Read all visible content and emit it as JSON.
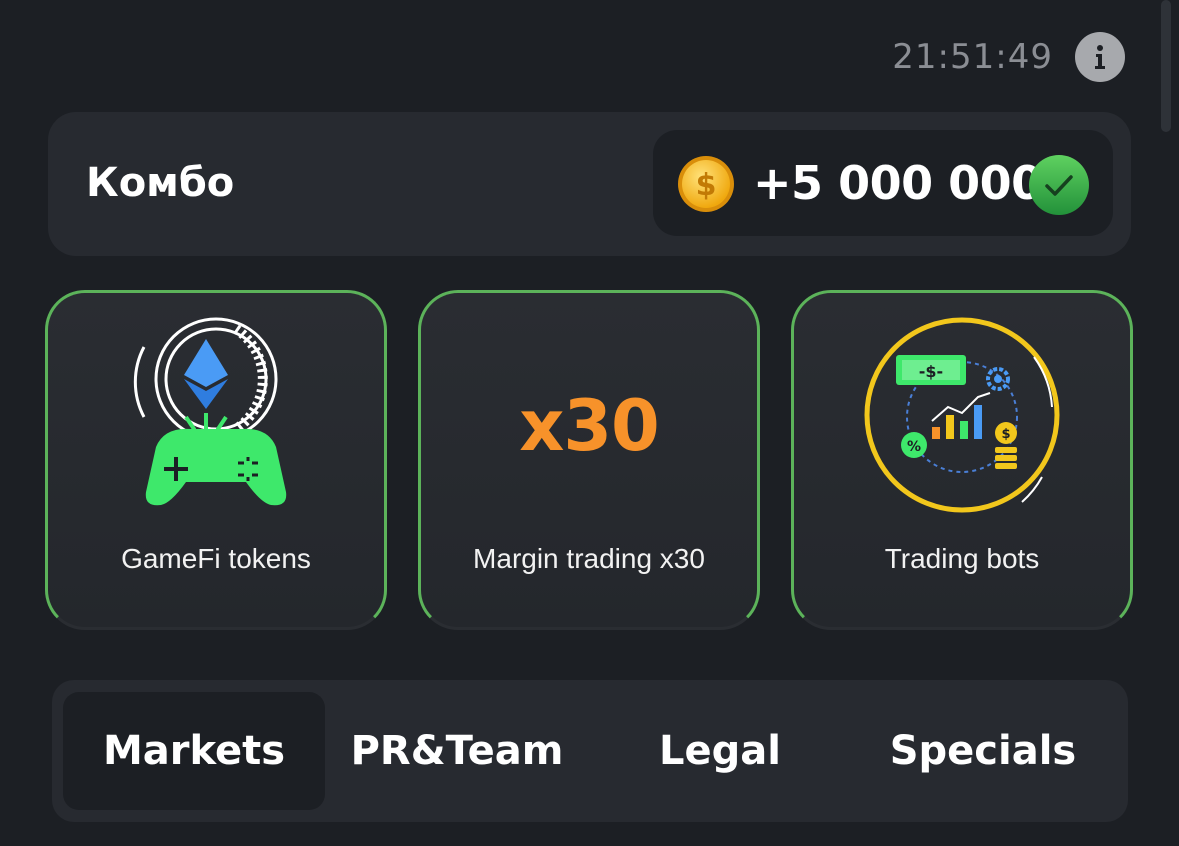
{
  "header": {
    "time": "21:51:49",
    "info_icon": "info-icon"
  },
  "combo": {
    "title": "Комбо",
    "reward": "+5 000 000",
    "coin_icon": "coin-dollar-icon",
    "status_icon": "check-circle-icon"
  },
  "cards": [
    {
      "label": "GameFi tokens",
      "icon": "gamepad-ethereum-icon"
    },
    {
      "label": "Margin trading x30",
      "badge": "x30"
    },
    {
      "label": "Trading bots",
      "icon": "trading-chart-icon"
    }
  ],
  "tabs": [
    {
      "label": "Markets",
      "active": true
    },
    {
      "label": "PR&Team",
      "active": false
    },
    {
      "label": "Legal",
      "active": false
    },
    {
      "label": "Specials",
      "active": false
    }
  ],
  "colors": {
    "background": "#1c1f24",
    "panel": "#272a30",
    "card_border": "#5cb35a",
    "accent_orange": "#f7922a",
    "success": "#3aa845",
    "gamepad_green": "#3ee86b",
    "eth_blue": "#3d8ef0",
    "bot_ring": "#f2c71c"
  }
}
